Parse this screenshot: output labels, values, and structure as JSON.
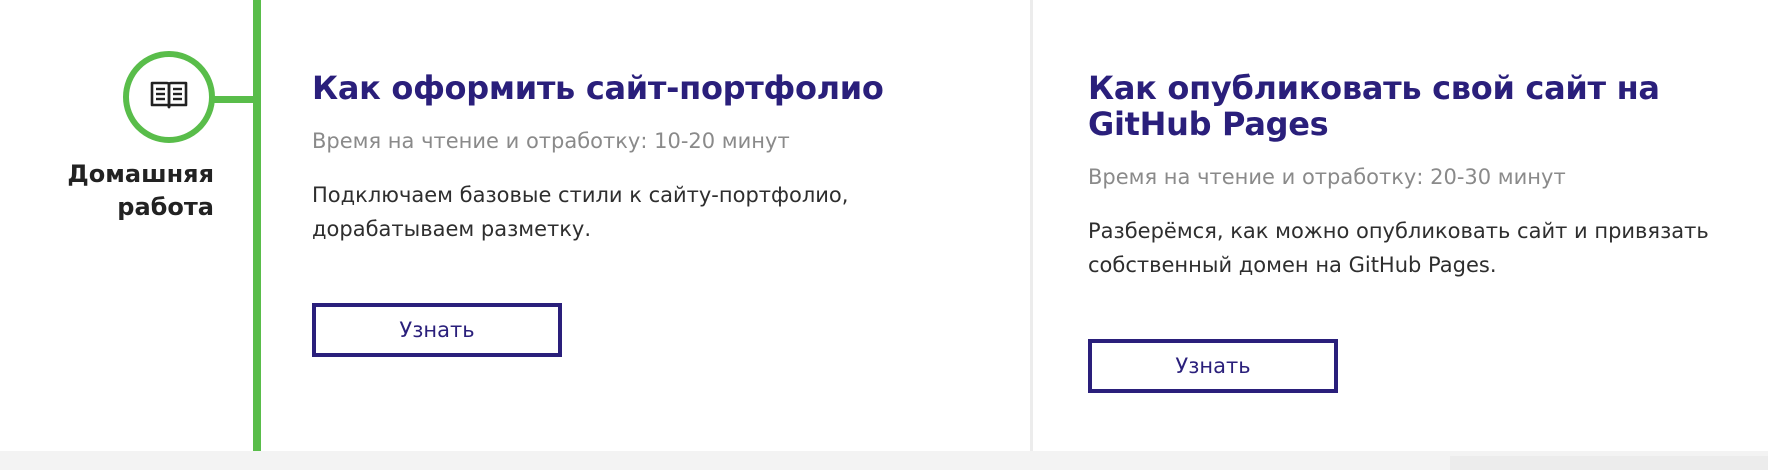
{
  "timeline": {
    "section_label": "Домашняя работа",
    "icon": "open-book-icon",
    "accent_color": "#59bd4a"
  },
  "cards": [
    {
      "title": "Как оформить сайт-портфолио",
      "time": "Время на чтение и отработку: 10-20 минут",
      "description": "Подключаем базовые стили к сайту-портфолио, дорабатываем разметку.",
      "button_label": "Узнать"
    },
    {
      "title": "Как опубликовать свой сайт на GitHub Pages",
      "time": "Время на чтение и отработку: 20-30 минут",
      "description": "Разберёмся, как можно опубликовать сайт и привязать собственный домен на GitHub Pages.",
      "button_label": "Узнать"
    }
  ],
  "colors": {
    "title": "#2a1f7b",
    "button_border": "#2a1f7b",
    "muted_text": "#8a8a8a",
    "body_text": "#2e2e2e"
  }
}
